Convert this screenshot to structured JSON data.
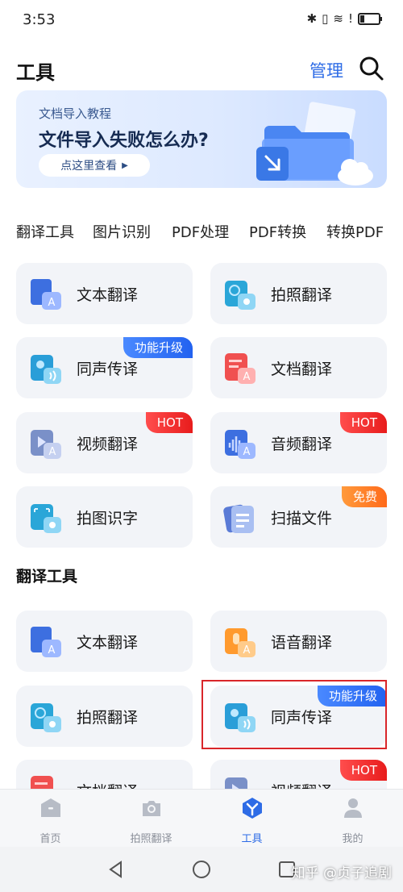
{
  "status": {
    "time": "3:53"
  },
  "header": {
    "title": "工具",
    "manage": "管理"
  },
  "banner": {
    "subtitle": "文档导入教程",
    "title": "文件导入失败怎么办?",
    "button": "点这里查看"
  },
  "categories": [
    "翻译工具",
    "图片识别",
    "PDF处理",
    "PDF转换",
    "转换PDF"
  ],
  "grid1": [
    {
      "label": "文本翻译",
      "icon": "text-translate-icon",
      "badge": ""
    },
    {
      "label": "拍照翻译",
      "icon": "photo-translate-icon",
      "badge": ""
    },
    {
      "label": "同声传译",
      "icon": "simultaneous-interpret-icon",
      "badge": "功能升级",
      "badge_color": "#2e6ce6"
    },
    {
      "label": "文档翻译",
      "icon": "document-translate-icon",
      "badge": ""
    },
    {
      "label": "视频翻译",
      "icon": "video-translate-icon",
      "badge": "HOT",
      "badge_color": "#e82020"
    },
    {
      "label": "音频翻译",
      "icon": "audio-translate-icon",
      "badge": "HOT",
      "badge_color": "#e82020"
    },
    {
      "label": "拍图识字",
      "icon": "photo-ocr-icon",
      "badge": ""
    },
    {
      "label": "扫描文件",
      "icon": "scan-file-icon",
      "badge": "免费",
      "badge_color": "#ff7a22"
    }
  ],
  "section2": {
    "title": "翻译工具"
  },
  "grid2": [
    {
      "label": "文本翻译",
      "icon": "text-translate-icon",
      "badge": ""
    },
    {
      "label": "语音翻译",
      "icon": "voice-translate-icon",
      "badge": ""
    },
    {
      "label": "拍照翻译",
      "icon": "photo-translate-icon",
      "badge": ""
    },
    {
      "label": "同声传译",
      "icon": "simultaneous-interpret-icon",
      "badge": "功能升级",
      "badge_color": "#2e6ce6"
    },
    {
      "label": "文档翻译",
      "icon": "document-translate-icon",
      "badge": ""
    },
    {
      "label": "视频翻译",
      "icon": "video-translate-icon",
      "badge": "HOT",
      "badge_color": "#e82020"
    }
  ],
  "bottom_nav": [
    {
      "label": "首页",
      "icon": "home-icon",
      "active": false
    },
    {
      "label": "拍照翻译",
      "icon": "camera-icon",
      "active": false
    },
    {
      "label": "工具",
      "icon": "tools-icon",
      "active": true
    },
    {
      "label": "我的",
      "icon": "profile-icon",
      "active": false
    }
  ],
  "watermark": "知乎 @贞子追剧",
  "colors": {
    "accent": "#2e6ce6",
    "hot": "#e82020",
    "free": "#ff7a22",
    "highlight": "#d9262a"
  }
}
